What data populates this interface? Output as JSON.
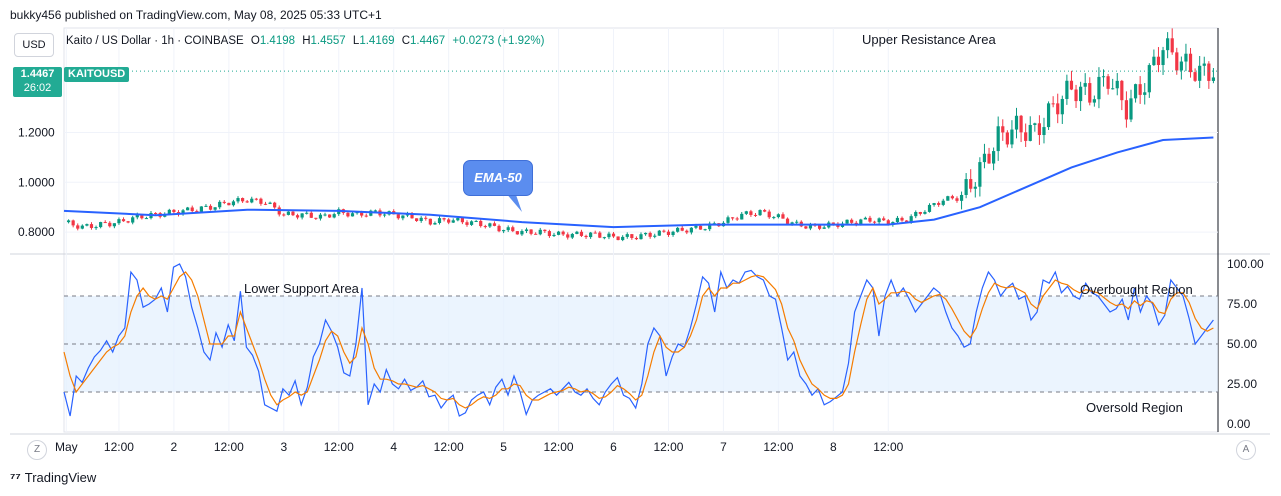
{
  "header": {
    "published": "bukky456 published on TradingView.com, May 08, 2025 05:33 UTC+1",
    "currency_button": "USD",
    "symbol": "Kaito / US Dollar · 1h · COINBASE",
    "ohlc": [
      {
        "key": "O",
        "value": "1.4198"
      },
      {
        "key": "H",
        "value": "1.4557"
      },
      {
        "key": "L",
        "value": "1.4169"
      },
      {
        "key": "C",
        "value": "1.4467"
      }
    ],
    "change": "+0.0273 (+1.92%)"
  },
  "price_tag": {
    "price": "1.4467",
    "countdown": "26:02",
    "ticker": "KAITOUSD"
  },
  "annotations": {
    "ema": "EMA-50",
    "upper": "Upper Resistance Area",
    "lower": "Lower Support Area",
    "overbought": "Overbought Region",
    "oversold": "Oversold Region"
  },
  "footer": {
    "brand": "TradingView",
    "z_button": "Z",
    "a_button": "A"
  },
  "colors": {
    "up": "#089981",
    "down": "#f23645",
    "ema": "#2962ff",
    "k_line": "#2962ff",
    "d_line": "#f57c00",
    "band": "#e3effd"
  },
  "chart_data": [
    {
      "type": "candlestick",
      "title": "",
      "ylim": [
        0.72,
        1.62
      ],
      "y_ticks": [
        "1.2000",
        "1.0000",
        "0.8000"
      ],
      "y_tick_values": [
        1.2,
        1.0,
        0.8
      ],
      "x_ticks": [
        "May",
        "12:00",
        "2",
        "12:00",
        "3",
        "12:00",
        "4",
        "12:00",
        "5",
        "12:00",
        "6",
        "12:00",
        "7",
        "12:00",
        "8",
        "12:00"
      ],
      "x_tick_values": [
        0.5,
        12,
        24,
        36,
        48,
        60,
        72,
        84,
        96,
        108,
        120,
        132,
        144,
        156,
        168,
        180
      ],
      "close_path": [
        [
          0,
          0.84
        ],
        [
          4,
          0.82
        ],
        [
          8,
          0.83
        ],
        [
          12,
          0.84
        ],
        [
          16,
          0.86
        ],
        [
          20,
          0.87
        ],
        [
          24,
          0.88
        ],
        [
          28,
          0.89
        ],
        [
          32,
          0.9
        ],
        [
          36,
          0.92
        ],
        [
          40,
          0.93
        ],
        [
          44,
          0.92
        ],
        [
          48,
          0.87
        ],
        [
          52,
          0.87
        ],
        [
          56,
          0.86
        ],
        [
          60,
          0.88
        ],
        [
          64,
          0.87
        ],
        [
          68,
          0.88
        ],
        [
          72,
          0.87
        ],
        [
          76,
          0.86
        ],
        [
          80,
          0.84
        ],
        [
          84,
          0.85
        ],
        [
          88,
          0.84
        ],
        [
          92,
          0.83
        ],
        [
          96,
          0.81
        ],
        [
          100,
          0.8
        ],
        [
          104,
          0.8
        ],
        [
          108,
          0.79
        ],
        [
          112,
          0.79
        ],
        [
          116,
          0.79
        ],
        [
          120,
          0.78
        ],
        [
          124,
          0.78
        ],
        [
          128,
          0.79
        ],
        [
          132,
          0.8
        ],
        [
          136,
          0.81
        ],
        [
          140,
          0.82
        ],
        [
          144,
          0.84
        ],
        [
          148,
          0.87
        ],
        [
          152,
          0.88
        ],
        [
          156,
          0.86
        ],
        [
          160,
          0.83
        ],
        [
          164,
          0.82
        ],
        [
          168,
          0.83
        ],
        [
          172,
          0.84
        ],
        [
          176,
          0.85
        ],
        [
          180,
          0.84
        ],
        [
          184,
          0.85
        ],
        [
          188,
          0.89
        ],
        [
          192,
          0.93
        ],
        [
          196,
          0.94
        ],
        [
          200,
          1.05
        ],
        [
          204,
          1.18
        ],
        [
          208,
          1.22
        ],
        [
          212,
          1.2
        ],
        [
          216,
          1.3
        ],
        [
          220,
          1.38
        ],
        [
          224,
          1.35
        ],
        [
          228,
          1.42
        ],
        [
          232,
          1.3
        ],
        [
          236,
          1.4
        ],
        [
          240,
          1.55
        ],
        [
          244,
          1.48
        ],
        [
          248,
          1.44
        ],
        [
          251,
          1.4467
        ]
      ],
      "ema_path": [
        [
          0,
          0.885
        ],
        [
          20,
          0.868
        ],
        [
          40,
          0.89
        ],
        [
          60,
          0.885
        ],
        [
          80,
          0.87
        ],
        [
          100,
          0.84
        ],
        [
          120,
          0.82
        ],
        [
          140,
          0.83
        ],
        [
          160,
          0.83
        ],
        [
          180,
          0.83
        ],
        [
          190,
          0.85
        ],
        [
          200,
          0.9
        ],
        [
          210,
          0.98
        ],
        [
          220,
          1.06
        ],
        [
          230,
          1.12
        ],
        [
          240,
          1.17
        ],
        [
          251,
          1.18
        ]
      ],
      "last_price": 1.4467
    },
    {
      "type": "line",
      "title": "",
      "ylim": [
        -5,
        105
      ],
      "y_ticks": [
        "100.00",
        "75.00",
        "50.00",
        "25.00",
        "0.00"
      ],
      "y_tick_values": [
        100,
        75,
        50,
        25,
        0
      ],
      "bands": [
        20,
        50,
        80
      ],
      "series": [
        {
          "role": "k",
          "values": [
            20,
            5,
            30,
            26,
            35,
            42,
            46,
            52,
            45,
            55,
            60,
            95,
            90,
            73,
            75,
            78,
            85,
            70,
            98,
            100,
            92,
            73,
            60,
            45,
            40,
            57,
            48,
            62,
            52,
            83,
            48,
            43,
            33,
            12,
            10,
            8,
            22,
            18,
            27,
            12,
            23,
            42,
            50,
            65,
            58,
            48,
            32,
            30,
            50,
            85,
            12,
            25,
            20,
            34,
            25,
            22,
            28,
            21,
            23,
            27,
            17,
            18,
            10,
            15,
            18,
            5,
            7,
            15,
            18,
            20,
            12,
            23,
            28,
            18,
            30,
            20,
            6,
            15,
            18,
            20,
            22,
            18,
            22,
            26,
            20,
            18,
            22,
            16,
            12,
            20,
            25,
            29,
            18,
            16,
            10,
            25,
            50,
            60,
            55,
            30,
            42,
            50,
            48,
            60,
            75,
            92,
            88,
            70,
            95,
            85,
            90,
            88,
            95,
            96,
            92,
            90,
            80,
            78,
            60,
            40,
            45,
            30,
            25,
            18,
            22,
            12,
            14,
            17,
            20,
            38,
            70,
            80,
            90,
            85,
            55,
            80,
            90,
            80,
            85,
            78,
            70,
            75,
            80,
            85,
            82,
            70,
            60,
            55,
            48,
            50,
            70,
            85,
            95,
            90,
            80,
            85,
            88,
            78,
            80,
            65,
            70,
            90,
            88,
            95,
            82,
            86,
            80,
            78,
            88,
            82,
            80,
            75,
            70,
            72,
            78,
            65,
            85,
            70,
            80,
            75,
            62,
            68,
            90,
            85,
            80,
            66,
            50,
            55,
            60,
            65
          ]
        },
        {
          "role": "d",
          "values": [
            45,
            30,
            20,
            25,
            30,
            35,
            40,
            45,
            48,
            50,
            55,
            70,
            80,
            85,
            80,
            78,
            80,
            78,
            85,
            92,
            95,
            90,
            80,
            65,
            50,
            50,
            50,
            55,
            55,
            70,
            60,
            50,
            40,
            28,
            18,
            12,
            15,
            17,
            20,
            18,
            20,
            30,
            40,
            52,
            58,
            55,
            45,
            38,
            42,
            60,
            50,
            35,
            28,
            28,
            27,
            25,
            25,
            24,
            23,
            24,
            22,
            20,
            16,
            15,
            16,
            12,
            10,
            12,
            15,
            17,
            16,
            18,
            22,
            22,
            25,
            24,
            18,
            15,
            15,
            17,
            19,
            20,
            21,
            23,
            22,
            20,
            21,
            19,
            16,
            17,
            20,
            24,
            22,
            19,
            15,
            18,
            30,
            45,
            55,
            48,
            45,
            45,
            48,
            55,
            65,
            80,
            85,
            80,
            85,
            85,
            88,
            88,
            90,
            92,
            93,
            92,
            88,
            84,
            75,
            60,
            52,
            40,
            32,
            25,
            22,
            18,
            16,
            16,
            18,
            25,
            45,
            62,
            78,
            85,
            75,
            78,
            82,
            82,
            83,
            82,
            78,
            76,
            78,
            80,
            81,
            78,
            72,
            65,
            58,
            54,
            60,
            72,
            82,
            88,
            86,
            85,
            86,
            84,
            82,
            75,
            72,
            80,
            85,
            90,
            88,
            87,
            84,
            82,
            84,
            83,
            82,
            79,
            76,
            74,
            75,
            72,
            77,
            74,
            77,
            76,
            70,
            69,
            78,
            82,
            82,
            76,
            66,
            60,
            58,
            60
          ]
        }
      ]
    }
  ]
}
